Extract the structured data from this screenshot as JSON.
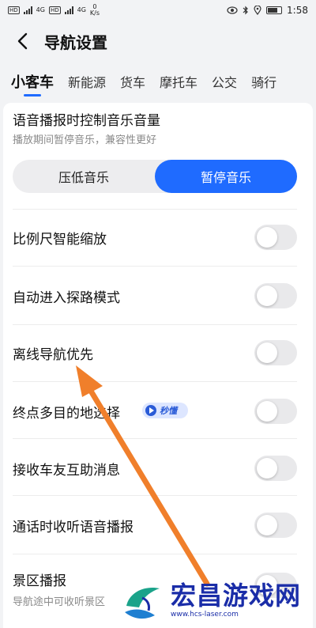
{
  "status_bar": {
    "net_speed": "0",
    "net_unit": "K/s",
    "time": "1:58",
    "tag1": "HD",
    "tag2": "HD",
    "sig1": "4G",
    "sig2": "4G"
  },
  "header": {
    "title": "导航设置"
  },
  "tabs": [
    {
      "label": "小客车",
      "active": true
    },
    {
      "label": "新能源"
    },
    {
      "label": "货车"
    },
    {
      "label": "摩托车"
    },
    {
      "label": "公交"
    },
    {
      "label": "骑行"
    }
  ],
  "audio": {
    "title": "语音播报时控制音乐音量",
    "subtitle": "播放期间暂停音乐，兼容性更好",
    "options": [
      "压低音乐",
      "暂停音乐"
    ],
    "selected": "暂停音乐"
  },
  "settings": [
    {
      "label": "比例尺智能缩放",
      "on": false
    },
    {
      "label": "自动进入探路模式",
      "on": false
    },
    {
      "label": "离线导航优先",
      "on": false
    },
    {
      "label": "终点多目的地选择",
      "badge": "秒懂",
      "on": false
    },
    {
      "label": "接收车友互助消息",
      "on": false
    },
    {
      "label": "通话时收听语音播报",
      "on": false
    },
    {
      "label": "景区播报",
      "subtitle": "导航途中可收听景区",
      "on": false
    }
  ],
  "watermark": {
    "brand": "宏昌游戏网",
    "url": "www.hcs-laser.com"
  },
  "colors": {
    "accent": "#1f6bff",
    "annotation_arrow": "#f07f2b",
    "watermark": "#1a2da8"
  }
}
